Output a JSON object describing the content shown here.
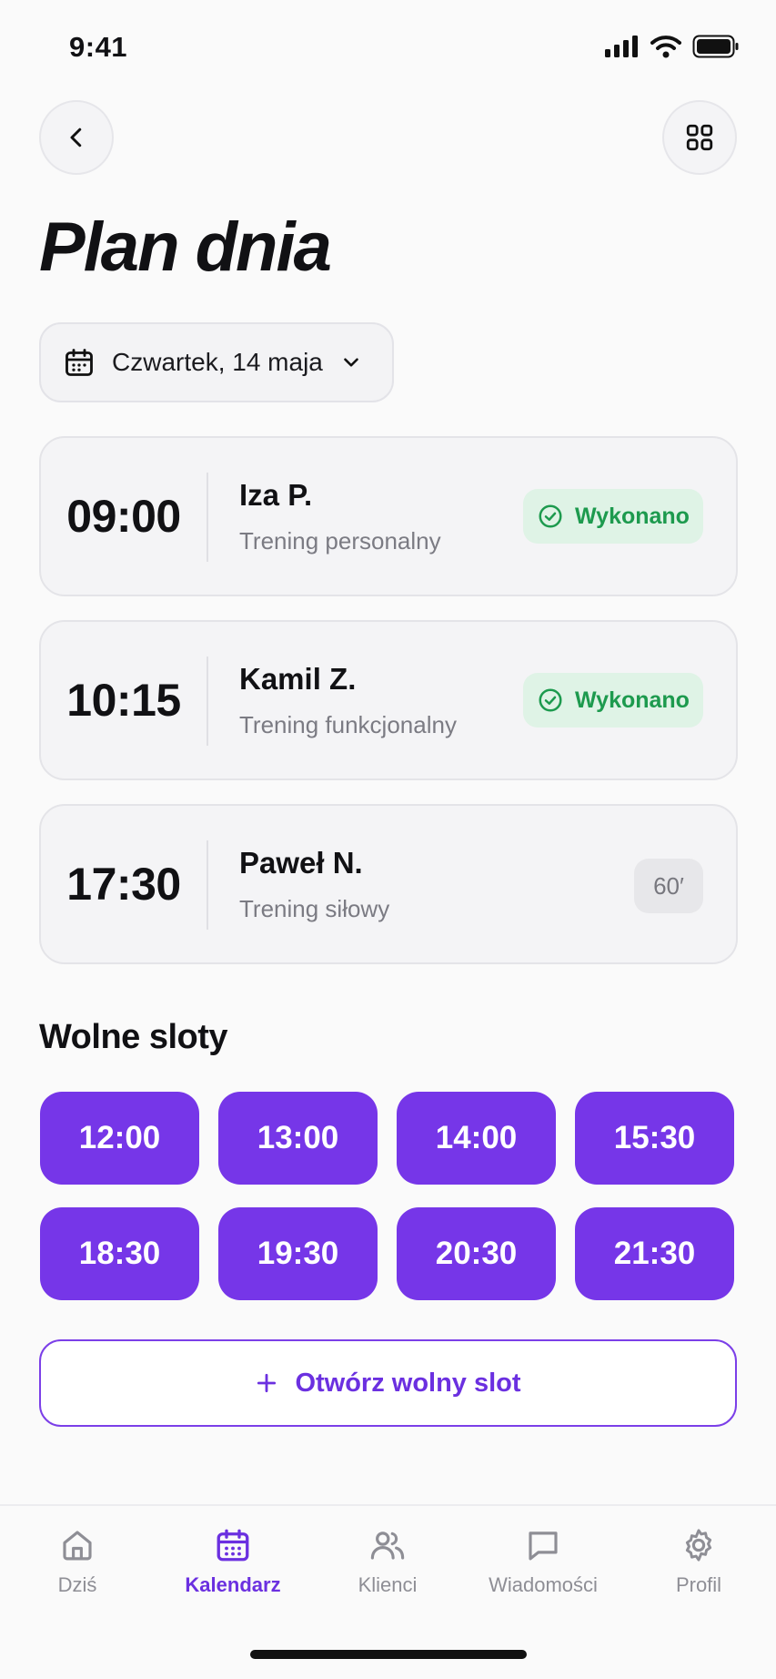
{
  "status_bar": {
    "time": "9:41"
  },
  "header": {
    "title": "Plan dnia"
  },
  "date_picker": {
    "label": "Czwartek, 14 maja"
  },
  "sessions": [
    {
      "time": "09:00",
      "client": "Iza P.",
      "type": "Trening personalny",
      "status": "Wykonano"
    },
    {
      "time": "10:15",
      "client": "Kamil Z.",
      "type": "Trening funkcjonalny",
      "status": "Wykonano"
    },
    {
      "time": "17:30",
      "client": "Paweł N.",
      "type": "Trening siłowy",
      "duration": "60′"
    }
  ],
  "free_slots": {
    "title": "Wolne sloty",
    "times": [
      "12:00",
      "13:00",
      "14:00",
      "15:30",
      "18:30",
      "19:30",
      "20:30",
      "21:30"
    ]
  },
  "open_slot_button": {
    "label": "Otwórz wolny slot"
  },
  "tabs": [
    {
      "label": "Dziś",
      "icon": "home-icon"
    },
    {
      "label": "Kalendarz",
      "icon": "calendar-icon",
      "active": true
    },
    {
      "label": "Klienci",
      "icon": "users-icon"
    },
    {
      "label": "Wiadomości",
      "icon": "message-icon"
    },
    {
      "label": "Profil",
      "icon": "gear-icon"
    }
  ],
  "colors": {
    "accent": "#7636e8",
    "success": "#1d9a4e",
    "success_bg": "#dff3e6"
  }
}
